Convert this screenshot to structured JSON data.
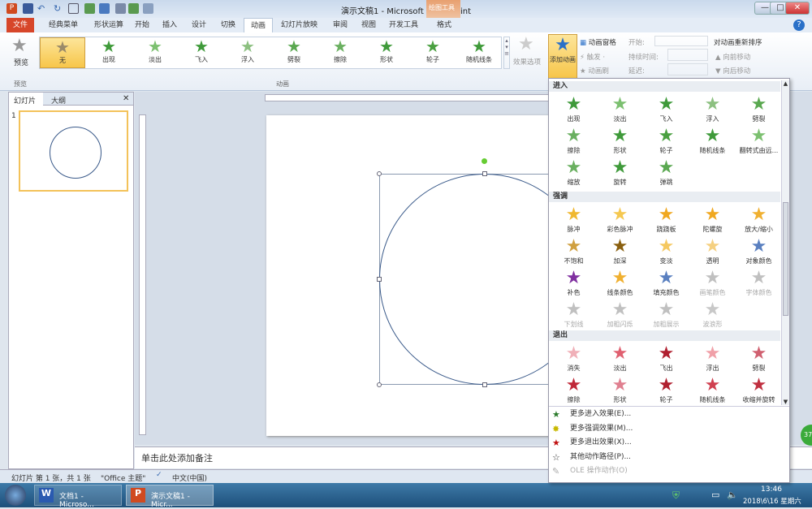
{
  "titlebar": {
    "title": "演示文稿1 - Microsoft PowerPoint",
    "context_tab": "绘图工具",
    "min": "—",
    "max": "□",
    "close": "✕"
  },
  "tabs": [
    "文件",
    "经典菜单",
    "形状运算",
    "开始",
    "插入",
    "设计",
    "切换",
    "动画",
    "幻灯片放映",
    "审阅",
    "视图",
    "开发工具",
    "格式"
  ],
  "active_tab": "动画",
  "ribbon": {
    "preview": "预览",
    "preview_group": "预览",
    "gallery": [
      {
        "label": "无",
        "color": "#9a8a6a"
      },
      {
        "label": "出现",
        "color": "#3f9a3a"
      },
      {
        "label": "淡出",
        "color": "#7cc070"
      },
      {
        "label": "飞入",
        "color": "#3f9a3a"
      },
      {
        "label": "浮入",
        "color": "#8cc080"
      },
      {
        "label": "劈裂",
        "color": "#5aa850"
      },
      {
        "label": "擦除",
        "color": "#6ab060"
      },
      {
        "label": "形状",
        "color": "#3f9a3a"
      },
      {
        "label": "轮子",
        "color": "#4aa040"
      },
      {
        "label": "随机线条",
        "color": "#3f9a3a"
      }
    ],
    "animation_group": "动画",
    "effect_options": "效果选项",
    "add_animation": "添加动画",
    "animation_pane": "动画窗格",
    "trigger": "触发 ·",
    "painter": "动画刷",
    "start": "开始:",
    "duration": "持续时间:",
    "delay": "延迟:",
    "reorder": "对动画重新排序",
    "move_earlier": "▲ 向前移动",
    "move_later": "▼ 向后移动"
  },
  "left_panel": {
    "tabs": [
      "幻灯片",
      "大纲"
    ],
    "slide_number": "1",
    "close": "✕"
  },
  "notes_placeholder": "单击此处添加备注",
  "menu": {
    "sections": [
      {
        "title": "进入",
        "items": [
          [
            "出现",
            "#3f9a3a"
          ],
          [
            "淡出",
            "#7cc070"
          ],
          [
            "飞入",
            "#3f9a3a"
          ],
          [
            "浮入",
            "#8cc080"
          ],
          [
            "劈裂",
            "#5aa850"
          ],
          [
            "擦除",
            "#6ab060"
          ],
          [
            "形状",
            "#3f9a3a"
          ],
          [
            "轮子",
            "#4aa040"
          ],
          [
            "随机线条",
            "#3f9a3a"
          ],
          [
            "翻转式由远...",
            "#7cc070"
          ],
          [
            "缩放",
            "#6ab060"
          ],
          [
            "旋转",
            "#3f9a3a"
          ],
          [
            "弹跳",
            "#5aa850"
          ]
        ]
      },
      {
        "title": "强调",
        "items": [
          [
            "脉冲",
            "#f0b830"
          ],
          [
            "彩色脉冲",
            "#f5c850"
          ],
          [
            "跷跷板",
            "#f0a820"
          ],
          [
            "陀螺旋",
            "#f0a820"
          ],
          [
            "放大/缩小",
            "#f0b030"
          ],
          [
            "不饱和",
            "#d0a040"
          ],
          [
            "加深",
            "#8a6010"
          ],
          [
            "变淡",
            "#f5c860"
          ],
          [
            "透明",
            "#f5d080"
          ],
          [
            "对象颜色",
            "#5a80c0"
          ],
          [
            "补色",
            "#8030a0"
          ],
          [
            "线条颜色",
            "#f0b030"
          ],
          [
            "填充颜色",
            "#5a80c0"
          ],
          [
            "画笔颜色",
            "#c0c0c0"
          ],
          [
            "字体颜色",
            "#c0c0c0"
          ],
          [
            "下划线",
            "#c0c0c0"
          ],
          [
            "加粗闪烁",
            "#c0c0c0"
          ],
          [
            "加粗展示",
            "#c0c0c0"
          ],
          [
            "波浪形",
            "#c8c8c8"
          ]
        ]
      },
      {
        "title": "退出",
        "items": [
          [
            "消失",
            "#f0b0b8"
          ],
          [
            "淡出",
            "#e06070"
          ],
          [
            "飞出",
            "#b02030"
          ],
          [
            "浮出",
            "#f0a0a8"
          ],
          [
            "劈裂",
            "#d06070"
          ],
          [
            "擦除",
            "#c02838"
          ],
          [
            "形状",
            "#e08090"
          ],
          [
            "轮子",
            "#b02030"
          ],
          [
            "随机线条",
            "#d04050"
          ],
          [
            "收缩并旋转",
            "#c03040"
          ]
        ]
      }
    ],
    "commands": [
      {
        "label": "更多进入效果(E)...",
        "icon": "★",
        "color": "#2a7a2a"
      },
      {
        "label": "更多强调效果(M)...",
        "icon": "✸",
        "color": "#c8b800"
      },
      {
        "label": "更多退出效果(X)...",
        "icon": "★",
        "color": "#c01010"
      },
      {
        "label": "其他动作路径(P)...",
        "icon": "☆",
        "color": "#333"
      },
      {
        "label": "OLE 操作动作(O)",
        "icon": "✎",
        "color": "#aaa",
        "disabled": true
      }
    ]
  },
  "status": {
    "slide": "幻灯片 第 1 张，共 1 张",
    "theme": "\"Office 主题\"",
    "lang": "中文(中国)"
  },
  "taskbar": {
    "items": [
      "文档1 - Microso...",
      "演示文稿1 - Micr..."
    ],
    "time": "13:46",
    "date": "2018\\6\\16 星期六"
  },
  "badge": "37"
}
